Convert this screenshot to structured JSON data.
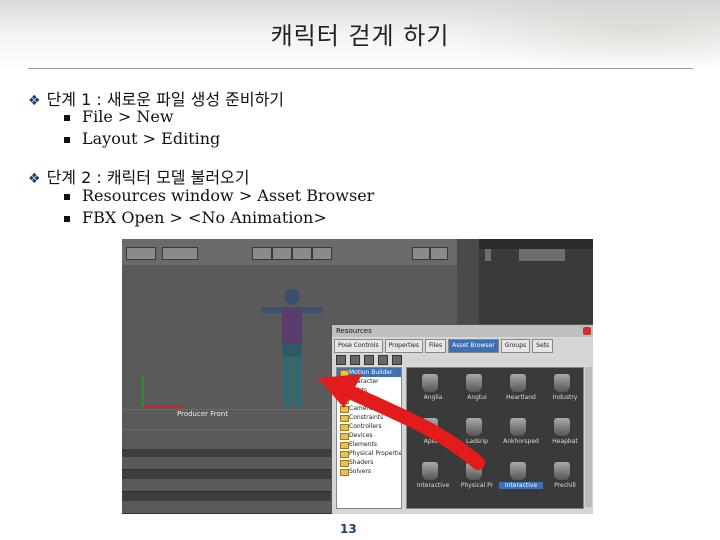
{
  "slide": {
    "title": "캐릭터 걷게 하기",
    "page_number": "13"
  },
  "steps": [
    {
      "label": "단계 1 : 새로운 파일 생성 준비하기",
      "items": [
        "File > New",
        "Layout > Editing"
      ]
    },
    {
      "label": "단계 2 : 캐릭터 모델 불러오기",
      "items": [
        "Resources window > Asset Browser",
        "FBX Open > <No Animation>"
      ]
    }
  ],
  "screenshot": {
    "viewport": {
      "front_label": "Producer Front"
    },
    "resources": {
      "title": "Resources",
      "tabs": [
        "Pose Controls",
        "Properties",
        "Files",
        "Asset Browser",
        "Groups",
        "Sets"
      ],
      "active_tab": "Asset Browser",
      "tree": [
        "Motion Builder",
        "Character",
        "Lights",
        "Misc",
        "Cameras",
        "Constraints",
        "Controllers",
        "Devices",
        "Elements",
        "Physical Properties",
        "Shaders",
        "Solvers"
      ],
      "assets": [
        "Anglia",
        "Angtui",
        "Heartland",
        "Industry",
        "Apsod",
        "Ladsrip",
        "Ankhorsped",
        "Heapbat",
        "Interactive",
        "Physical Pr",
        "Interactive",
        "Prechill"
      ]
    }
  },
  "colors": {
    "accent": "#1f3f77",
    "arrow": "#e31b1b",
    "selection": "#3d6fb5"
  }
}
